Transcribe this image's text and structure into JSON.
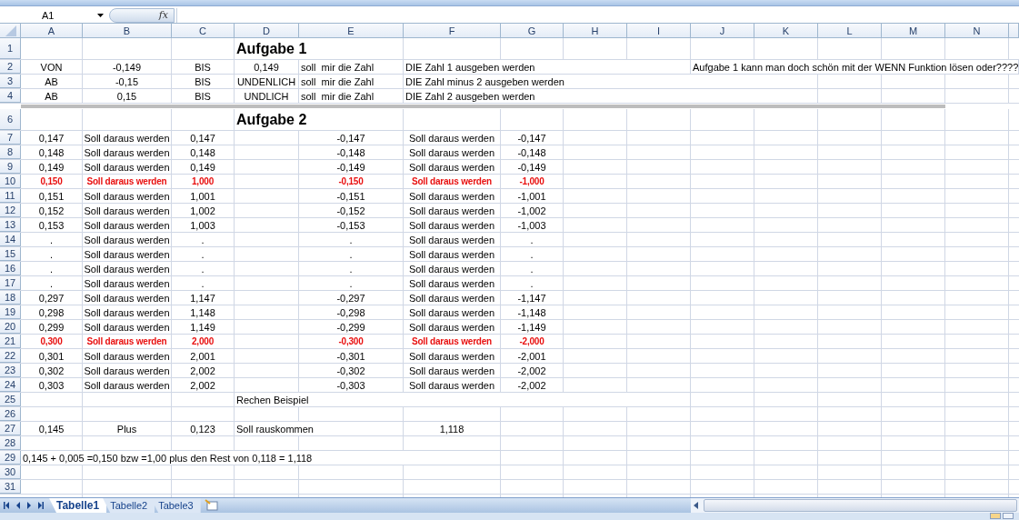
{
  "name_box": "A1",
  "function_label": "fx",
  "columns": [
    "A",
    "B",
    "C",
    "D",
    "E",
    "F",
    "G",
    "H",
    "I",
    "J",
    "K",
    "L",
    "M",
    "N"
  ],
  "rows": [
    {
      "number": "1",
      "cells": [
        null,
        null,
        null,
        {
          "kind": "heading",
          "text": "Aufgabe 1"
        }
      ]
    },
    {
      "number": "2",
      "cells": [
        "VON",
        "-0,149",
        "BIS",
        "0,149",
        {
          "kind": "overflow",
          "text": "soll  mir die Zahl"
        },
        {
          "kind": "overflow",
          "text": "DIE Zahl 1 ausgeben werden"
        },
        null,
        null,
        null,
        {
          "kind": "overflow",
          "text": "Aufgabe 1 kann man doch schön mit der WENN Funktion lösen oder????"
        }
      ]
    },
    {
      "number": "3",
      "cells": [
        "AB",
        "-0,15",
        "BIS",
        "UNDENLICH",
        {
          "kind": "overflow",
          "text": "soll  mir die Zahl"
        },
        {
          "kind": "overflow",
          "text": "DIE Zahl minus 2 ausgeben werden"
        }
      ]
    },
    {
      "number": "4",
      "cells": [
        "AB",
        "0,15",
        "BIS",
        "UNDLICH",
        {
          "kind": "overflow",
          "text": "soll  mir die Zahl"
        },
        {
          "kind": "overflow",
          "text": "DIE Zahl 2 ausgeben werden"
        }
      ]
    },
    {
      "kind": "separator"
    },
    {
      "number": "6",
      "cells": [
        null,
        null,
        null,
        {
          "kind": "heading",
          "text": "Aufgabe 2"
        }
      ]
    },
    {
      "number": "7",
      "highlighted": false,
      "cells": [
        "0,147",
        "Soll daraus werden",
        "0,147",
        null,
        "-0,147",
        "Soll daraus werden",
        "-0,147"
      ]
    },
    {
      "number": "8",
      "highlighted": false,
      "cells": [
        "0,148",
        "Soll daraus werden",
        "0,148",
        null,
        "-0,148",
        "Soll daraus werden",
        "-0,148"
      ]
    },
    {
      "number": "9",
      "highlighted": false,
      "cells": [
        "0,149",
        "Soll daraus werden",
        "0,149",
        null,
        "-0,149",
        "Soll daraus werden",
        "-0,149"
      ]
    },
    {
      "number": "10",
      "highlighted": true,
      "cells": [
        "0,150",
        "Soll daraus werden",
        "1,000",
        null,
        "-0,150",
        "Soll daraus werden",
        "-1,000"
      ]
    },
    {
      "number": "11",
      "highlighted": false,
      "cells": [
        "0,151",
        "Soll daraus werden",
        "1,001",
        null,
        "-0,151",
        "Soll daraus werden",
        "-1,001"
      ]
    },
    {
      "number": "12",
      "highlighted": false,
      "cells": [
        "0,152",
        "Soll daraus werden",
        "1,002",
        null,
        "-0,152",
        "Soll daraus werden",
        "-1,002"
      ]
    },
    {
      "number": "13",
      "highlighted": false,
      "cells": [
        "0,153",
        "Soll daraus werden",
        "1,003",
        null,
        "-0,153",
        "Soll daraus werden",
        "-1,003"
      ]
    },
    {
      "number": "14",
      "highlighted": false,
      "cells": [
        ".",
        "Soll daraus werden",
        ".",
        null,
        ".",
        "Soll daraus werden",
        "."
      ]
    },
    {
      "number": "15",
      "highlighted": false,
      "cells": [
        ".",
        "Soll daraus werden",
        ".",
        null,
        ".",
        "Soll daraus werden",
        "."
      ]
    },
    {
      "number": "16",
      "highlighted": false,
      "cells": [
        ".",
        "Soll daraus werden",
        ".",
        null,
        ".",
        "Soll daraus werden",
        "."
      ]
    },
    {
      "number": "17",
      "highlighted": false,
      "cells": [
        ".",
        "Soll daraus werden",
        ".",
        null,
        ".",
        "Soll daraus werden",
        "."
      ]
    },
    {
      "number": "18",
      "highlighted": false,
      "cells": [
        "0,297",
        "Soll daraus werden",
        "1,147",
        null,
        "-0,297",
        "Soll daraus werden",
        "-1,147"
      ]
    },
    {
      "number": "19",
      "highlighted": false,
      "cells": [
        "0,298",
        "Soll daraus werden",
        "1,148",
        null,
        "-0,298",
        "Soll daraus werden",
        "-1,148"
      ]
    },
    {
      "number": "20",
      "highlighted": false,
      "cells": [
        "0,299",
        "Soll daraus werden",
        "1,149",
        null,
        "-0,299",
        "Soll daraus werden",
        "-1,149"
      ]
    },
    {
      "number": "21",
      "highlighted": true,
      "cells": [
        "0,300",
        "Soll daraus werden",
        "2,000",
        null,
        "-0,300",
        "Soll daraus werden",
        "-2,000"
      ]
    },
    {
      "number": "22",
      "highlighted": false,
      "cells": [
        "0,301",
        "Soll daraus werden",
        "2,001",
        null,
        "-0,301",
        "Soll daraus werden",
        "-2,001"
      ]
    },
    {
      "number": "23",
      "highlighted": false,
      "cells": [
        "0,302",
        "Soll daraus werden",
        "2,002",
        null,
        "-0,302",
        "Soll daraus werden",
        "-2,002"
      ]
    },
    {
      "number": "24",
      "highlighted": false,
      "cells": [
        "0,303",
        "Soll daraus werden",
        "2,002",
        null,
        "-0,303",
        "Soll daraus werden",
        "-2,002"
      ]
    },
    {
      "number": "25",
      "cells": [
        null,
        null,
        null,
        {
          "kind": "overflow",
          "text": "Rechen Beispiel"
        }
      ]
    },
    {
      "number": "26",
      "cells": []
    },
    {
      "number": "27",
      "cells": [
        "0,145",
        "Plus",
        "0,123",
        {
          "kind": "overflow",
          "text": "Soll rauskommen"
        },
        null,
        "1,118"
      ]
    },
    {
      "number": "28",
      "cells": []
    },
    {
      "number": "29",
      "cells": [
        {
          "kind": "overflow",
          "text": "0,145 + 0,005 =0,150 bzw =1,00 plus den Rest von 0,118 = 1,118"
        }
      ]
    },
    {
      "number": "30",
      "cells": []
    },
    {
      "number": "31",
      "cells": []
    }
  ],
  "sheet_tabs": [
    {
      "label": "Tabelle1",
      "selected": true
    },
    {
      "label": "Tabelle2",
      "selected": false
    },
    {
      "label": "Tabele3",
      "selected": false
    }
  ]
}
